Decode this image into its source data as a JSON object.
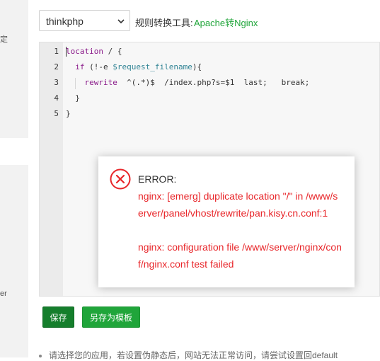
{
  "sidebar": {
    "fragment_top": "定",
    "fragment_bottom": "er"
  },
  "rewrite": {
    "select_value": "thinkphp",
    "tool_label": "规则转换工具:",
    "tool_link": "Apache转Nginx"
  },
  "editor": {
    "line_numbers": [
      "1",
      "2",
      "3",
      "4",
      "5"
    ],
    "lines": [
      "location / {",
      "  if (!-e $request_filename){",
      "    rewrite  ^(.*)$  /index.php?s=$1  last;   break;",
      "  }",
      "}"
    ]
  },
  "buttons": {
    "save": "保存",
    "save_as_template": "另存为模板"
  },
  "note": "请选择您的应用，若设置伪静态后，网站无法正常访问，请尝试设置回default",
  "error": {
    "title": "ERROR:",
    "message_1": "nginx: [emerg] duplicate location \"/\" in /www/server/panel/vhost/rewrite/pan.kisy.cn.conf:1",
    "message_2": "nginx: configuration file /www/server/nginx/conf/nginx.conf test failed",
    "accent_color": "#e8262a"
  }
}
